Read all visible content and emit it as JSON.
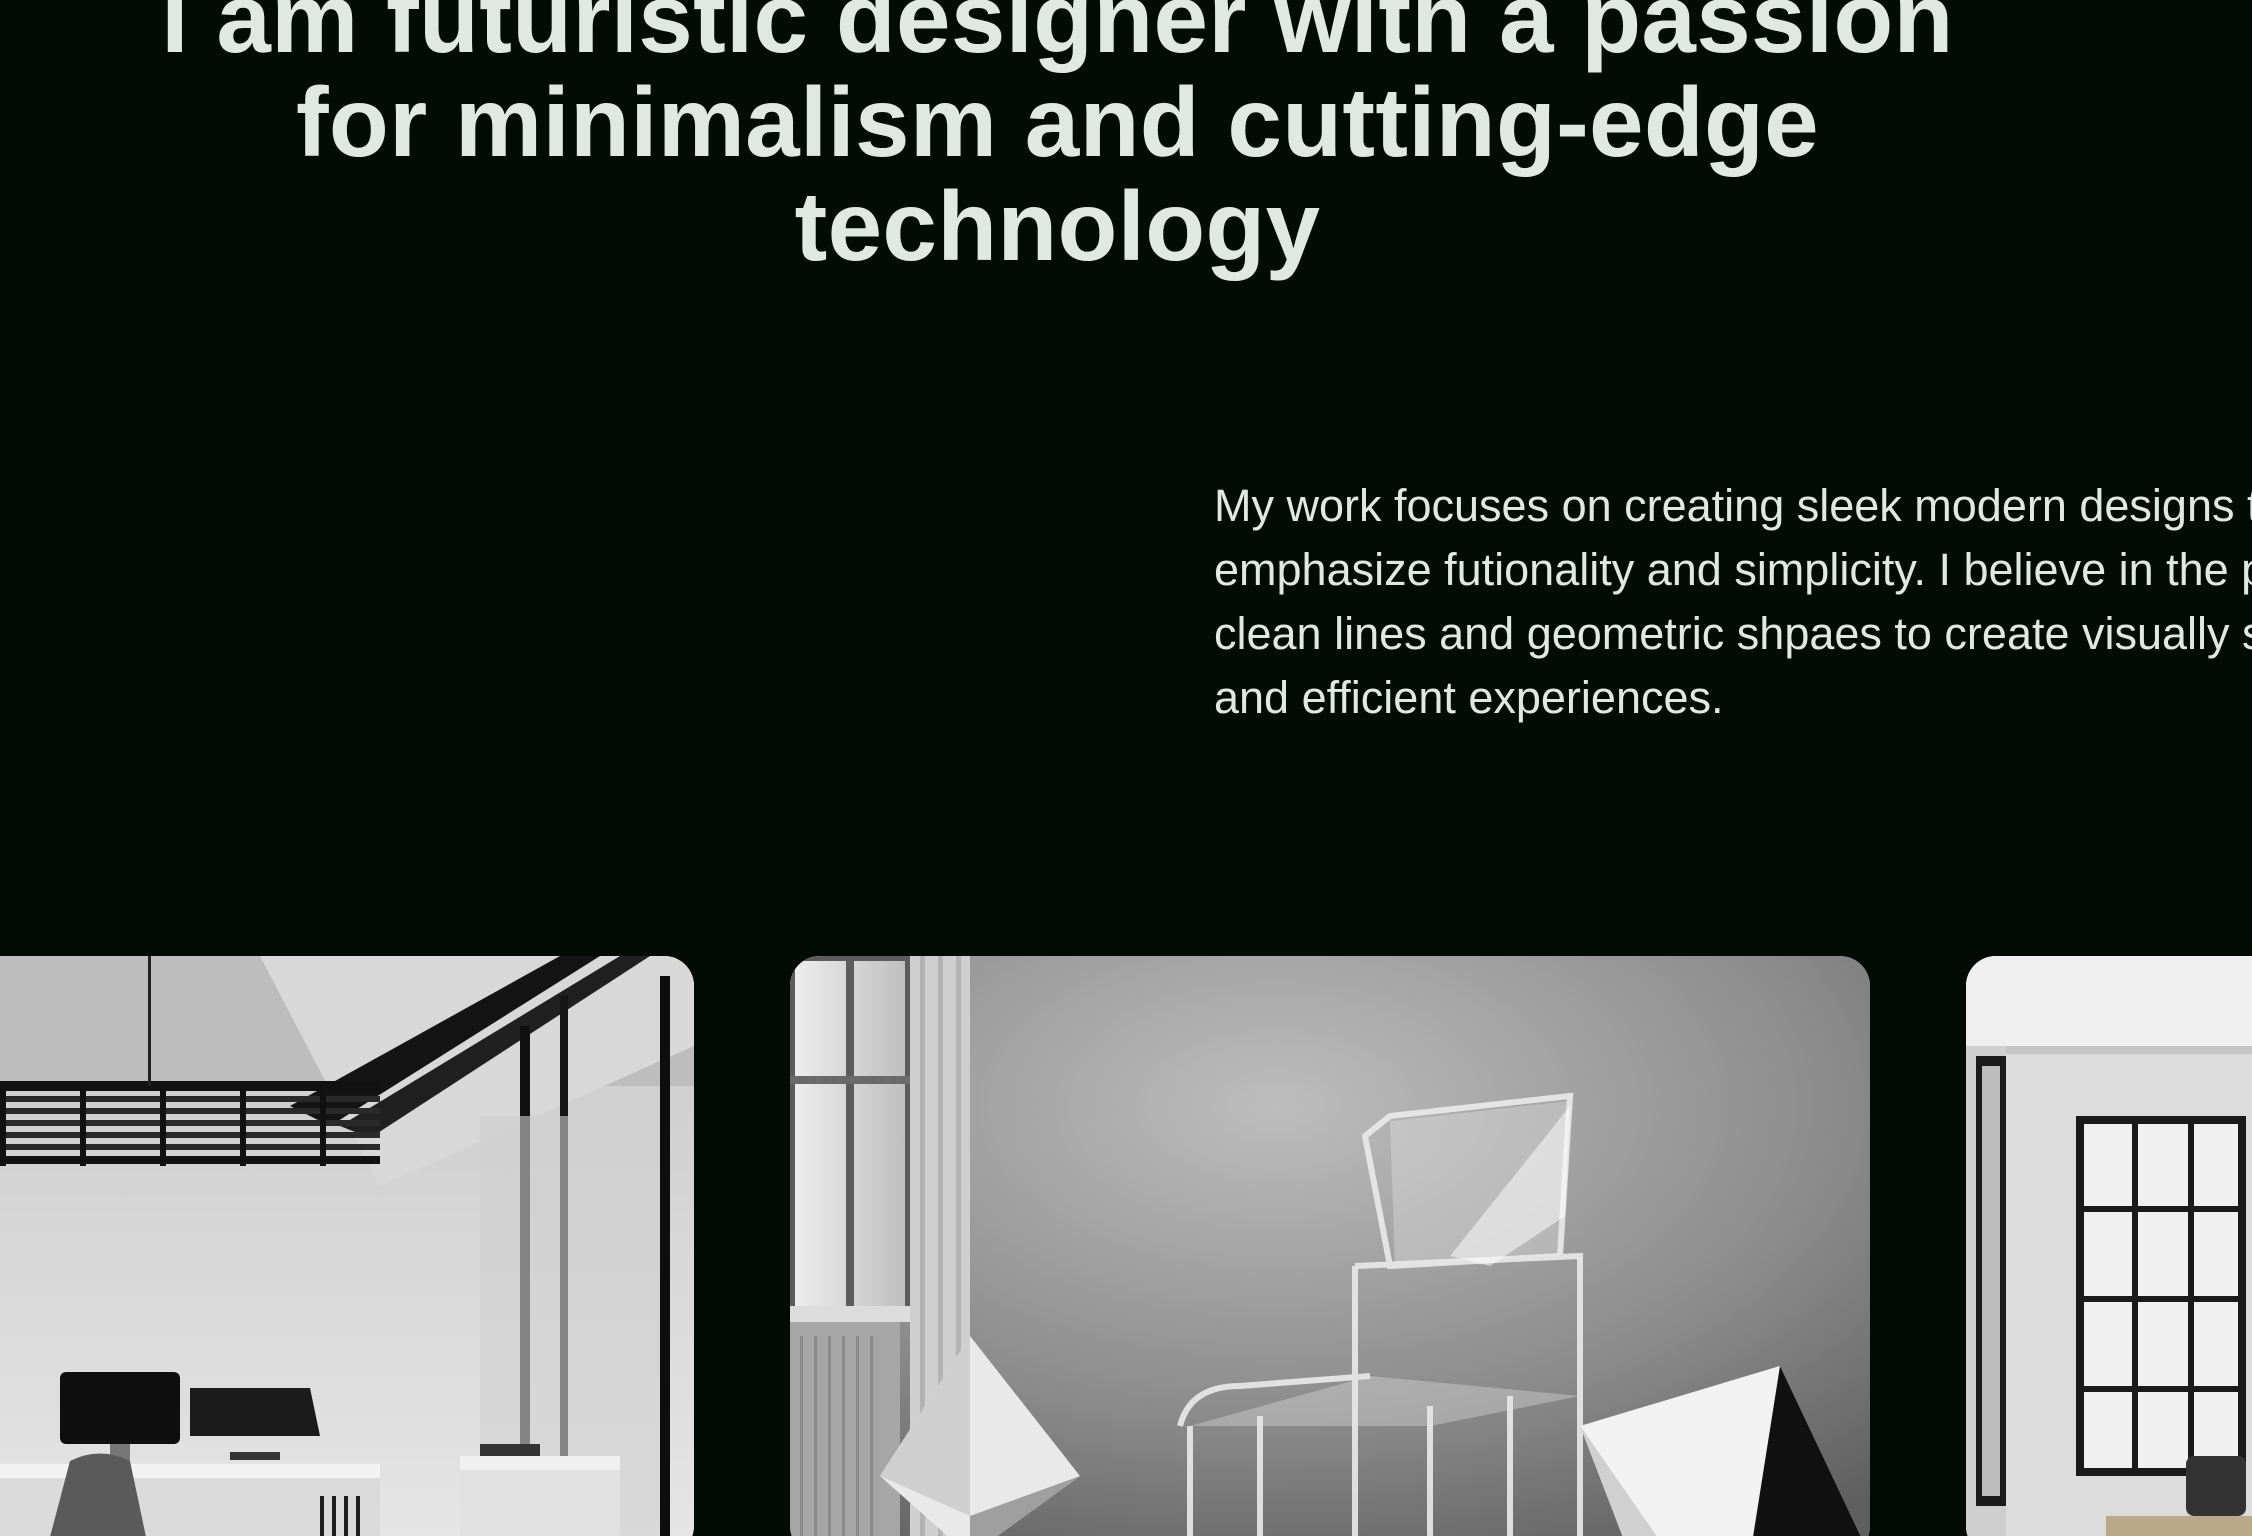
{
  "hero": {
    "title_lines": [
      "I am futuristic designer with a passion",
      "for minimalism and cutting-edge",
      "technology"
    ]
  },
  "intro": {
    "lines": [
      "My work focuses on creating sleek modern designs that",
      "emphasize futionality and simplicity. I believe in the power of",
      "clean lines and geometric shpaes to create visually striking",
      "and efficient experiences."
    ]
  },
  "gallery": {
    "items": [
      {
        "subject": "minimalist-office-image"
      },
      {
        "subject": "acrylic-chair-geometric-shapes-image"
      },
      {
        "subject": "bright-office-windows-image"
      }
    ]
  },
  "colors": {
    "background": "#030b05",
    "text": "#dfe9e1"
  }
}
